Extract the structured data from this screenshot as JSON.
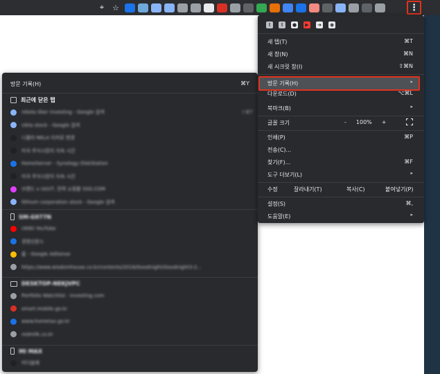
{
  "toolbar": {
    "locate_icon": "⌖",
    "star_icon": "☆",
    "extension_colors": [
      "#1a73e8",
      "#6fa8dc",
      "#8ab4f8",
      "#8ab4f8",
      "#9aa0a6",
      "#9aa0a6",
      "#e8eaed",
      "#d93025",
      "#9aa0a6",
      "#5f6368",
      "#34a853",
      "#e8710a",
      "#4285f4",
      "#1a73e8",
      "#f28b82",
      "#5f6368",
      "#8ab4f8",
      "#9aa0a6",
      "#5f6368",
      "#9aa0a6"
    ],
    "menu_icon": "⋮"
  },
  "menu": {
    "extensions": [
      {
        "icon": "bookmark-icon",
        "glyph": "!",
        "color": "#bdc1c6"
      },
      {
        "icon": "bookmark-icon",
        "glyph": "!",
        "color": "#bdc1c6"
      },
      {
        "icon": "record-icon",
        "glyph": "●",
        "color": "#e8eaed"
      },
      {
        "icon": "youtube-icon",
        "glyph": "▶",
        "color": "#ff3b30"
      },
      {
        "icon": "arrow-icon",
        "glyph": "➜",
        "color": "#e8eaed"
      },
      {
        "icon": "compass-icon",
        "glyph": "◉",
        "color": "#e8eaed"
      }
    ],
    "new_tab": {
      "label": "새 탭(T)",
      "shortcut": "⌘T"
    },
    "new_window": {
      "label": "새 창(N)",
      "shortcut": "⌘N"
    },
    "new_incognito": {
      "label": "새 시크릿 창(I)",
      "shortcut": "⇧⌘N"
    },
    "history": {
      "label": "방문 기록(H)",
      "arrow": "▸"
    },
    "downloads": {
      "label": "다운로드(D)",
      "shortcut": "⌥⌘L"
    },
    "bookmarks": {
      "label": "북마크(B)",
      "arrow": "▸"
    },
    "zoom": {
      "label": "글꼴 크기",
      "minus": "-",
      "value": "100%",
      "plus": "+"
    },
    "print": {
      "label": "인쇄(P)",
      "shortcut": "⌘P"
    },
    "cast": {
      "label": "전송(C)..."
    },
    "find": {
      "label": "찾기(F)...",
      "shortcut": "⌘F"
    },
    "more_tools": {
      "label": "도구 더보기(L)",
      "arrow": "▸"
    },
    "edit": {
      "label": "수정",
      "cut": "잘라내기(T)",
      "copy": "복사(C)",
      "paste": "붙여넣기(P)"
    },
    "settings": {
      "label": "설정(S)",
      "shortcut": "⌘,"
    },
    "help": {
      "label": "도움말(E)",
      "arrow": "▸"
    }
  },
  "history": {
    "header": {
      "label": "방문 기록(H)",
      "shortcut": "⌘Y"
    },
    "recently_closed": {
      "title": "최근에 닫은 탭",
      "items": [
        {
          "text": "nikola tiker investing - Google 검색",
          "shortcut": "⇧⌘T",
          "color": "#8ab4f8"
        },
        {
          "text": "nikla stock - Google 검색",
          "color": "#8ab4f8"
        },
        {
          "text": "니콜라 NKLA 티커로 변경",
          "color": "#202124"
        },
        {
          "text": "미국 주식시장이 지속 시간",
          "color": "#202124"
        },
        {
          "text": "HomeServer - Synology DiskStation",
          "color": "#1a73e8"
        },
        {
          "text": "미국 주식시장이 지속 시간",
          "color": "#202124"
        },
        {
          "text": "브랜드 x UI/UT, 전략 쇼핑몰 SSG.COM",
          "color": "#e040fb"
        },
        {
          "text": "lithium corporation stock - Google 검색",
          "color": "#8ab4f8"
        }
      ]
    },
    "device1": {
      "title": "SM-G977N",
      "items": [
        {
          "text": "(406) YouTube",
          "color": "#ff0000"
        },
        {
          "text": "경향신문스",
          "color": "#1a73e8"
        },
        {
          "text": "홈 - Google AdSense",
          "color": "#fbbc04"
        },
        {
          "text": "https://www.wisdomhouse.co.kr/contents/2016/Goodnight/Goodnight3-2...",
          "color": "#9aa0a6"
        }
      ]
    },
    "device2": {
      "title": "DESKTOP-NEKJVPC",
      "items": [
        {
          "text": "Portfolio Watchlist - Investing.com",
          "color": "#9aa0a6"
        },
        {
          "text": "smart.mobile.go.kr",
          "color": "#d93025"
        },
        {
          "text": "www.hometax.go.kr",
          "color": "#1a73e8"
        },
        {
          "text": "redmilk.co.kr",
          "color": "#9aa0a6"
        }
      ]
    },
    "device3": {
      "title": "MI MAX",
      "items": [
        {
          "text": "미디움웨",
          "color": "#202124"
        }
      ]
    }
  }
}
